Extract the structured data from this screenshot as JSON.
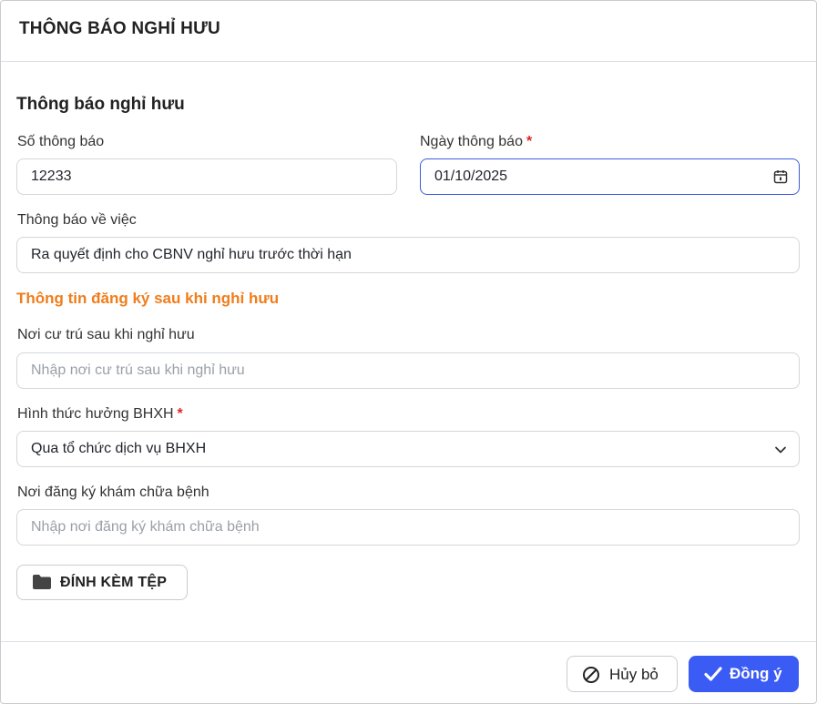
{
  "dialog": {
    "title": "THÔNG BÁO NGHỈ HƯU"
  },
  "section": {
    "title": "Thông báo nghỉ hưu"
  },
  "notice_number": {
    "label": "Số thông báo",
    "value": "12233"
  },
  "notice_date": {
    "label": "Ngày thông báo",
    "required_mark": "*",
    "value": "01/10/2025"
  },
  "notice_subject": {
    "label": "Thông báo về việc",
    "value": "Ra quyết định cho CBNV nghỉ hưu trước thời hạn"
  },
  "subsection": {
    "title": "Thông tin đăng ký sau khi nghỉ hưu"
  },
  "residence": {
    "label": "Nơi cư trú sau khi nghỉ hưu",
    "placeholder": "Nhập nơi cư trú sau khi nghỉ hưu"
  },
  "insurance_method": {
    "label": "Hình thức hưởng BHXH",
    "required_mark": "*",
    "value": "Qua tổ chức dịch vụ BHXH"
  },
  "medical_place": {
    "label": "Nơi đăng ký khám chữa bệnh",
    "placeholder": "Nhập nơi đăng ký khám chữa bệnh"
  },
  "attach": {
    "label": "ĐÍNH KÈM TỆP",
    "icon": "folder-icon"
  },
  "footer": {
    "cancel_label": "Hủy bỏ",
    "cancel_icon": "ban-icon",
    "ok_label": "Đồng ý",
    "ok_icon": "check-icon"
  },
  "colors": {
    "accent": "#3b5bf5",
    "subsection": "#f07d1b",
    "required": "#e02424"
  }
}
